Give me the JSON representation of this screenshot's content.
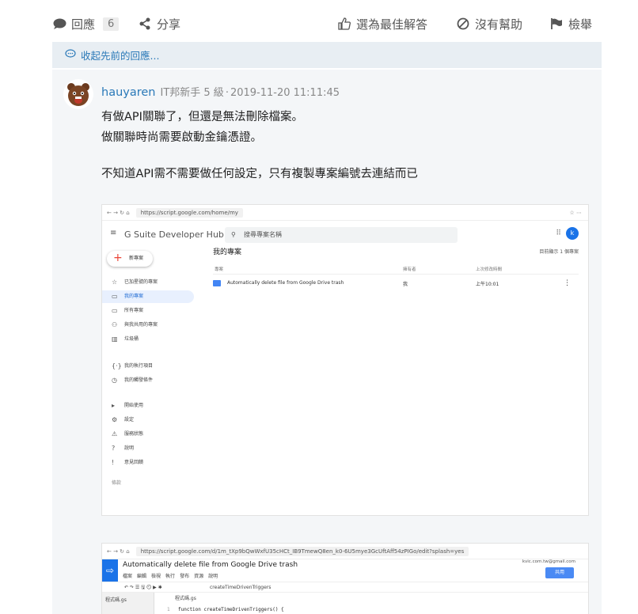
{
  "action_bar": {
    "reply_label": "回應",
    "reply_count": "6",
    "share_label": "分享",
    "best_answer_label": "選為最佳解答",
    "not_helpful_label": "沒有幫助",
    "report_label": "檢舉"
  },
  "collapse": {
    "label": "收起先前的回應..."
  },
  "reply": {
    "username": "hauyaren",
    "user_level": "IT邦新手 5 級",
    "separator": "‧",
    "timestamp": "2019-11-20 11:11:45",
    "lines": [
      "有做API關聯了，但還是無法刪除檔案。",
      "做關聯時尚需要啟動金鑰憑證。",
      "不知道API需不需要做任何設定，只有複製專案編號去連結而已"
    ]
  },
  "screenshot1": {
    "url": "https://script.google.com/home/my",
    "app_title": "G Suite Developer Hub",
    "search_placeholder": "搜尋專案名稱",
    "avatar_letter": "k",
    "new_button": "新專案",
    "nav": [
      {
        "icon": "☆",
        "label": "已加星號的專案"
      },
      {
        "icon": "▭",
        "label": "我的專案"
      },
      {
        "icon": "▭",
        "label": "所有專案"
      },
      {
        "icon": "⚇",
        "label": "與我共用的專案"
      },
      {
        "icon": "▥",
        "label": "垃圾桶"
      },
      {
        "icon": "{·}",
        "label": "我的執行項目"
      },
      {
        "icon": "◷",
        "label": "我的觸發條件"
      },
      {
        "icon": "▸",
        "label": "開始使用"
      },
      {
        "icon": "⚙",
        "label": "設定"
      },
      {
        "icon": "⚠",
        "label": "服務狀態"
      },
      {
        "icon": "?",
        "label": "說明"
      },
      {
        "icon": "!",
        "label": "意見回饋"
      }
    ],
    "footer": "條款",
    "main_title": "我的專案",
    "right_note": "目前顯示 1 個專案",
    "columns": [
      "專案",
      "擁有者",
      "上次修改時間"
    ],
    "row": {
      "name": "Automatically delete file from Google Drive trash",
      "owner": "我",
      "modified": "上午10:01"
    }
  },
  "screenshot2": {
    "url": "https://script.google.com/d/1m_tXp9bQwWxfU35cHCt_IB9TmewQ8en_k0-6U5mye3GcUftAff54zPIGo/edit?splash=yes",
    "title": "Automatically delete file from Google Drive trash",
    "menu": [
      "檔案",
      "編輯",
      "檢視",
      "執行",
      "發布",
      "資源",
      "說明"
    ],
    "account": "kvic.com.tw@gmail.com",
    "share_label": "共用",
    "function_select": "createTimeDrivenTriggers",
    "file_item": "程式碼.gs",
    "tab": "程式碼.gs",
    "line_number": "1",
    "code": "function createTimeDrivenTriggers() {"
  }
}
